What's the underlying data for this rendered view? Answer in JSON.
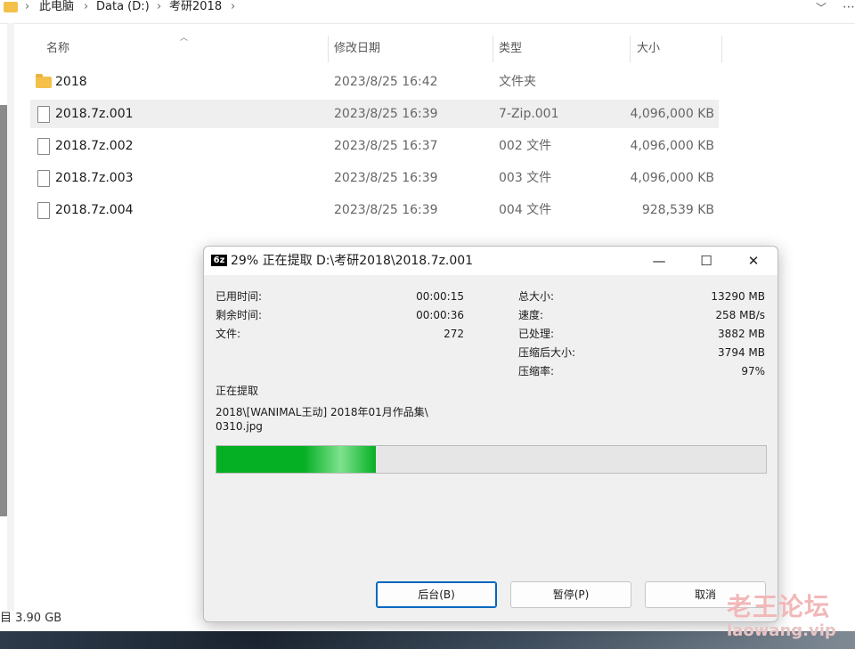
{
  "address_bar": {
    "crumbs": [
      "此电脑",
      "Data (D:)",
      "考研2018"
    ],
    "separator": "›",
    "more_glyph": "⋯",
    "dropdown_glyph": "﹀"
  },
  "columns": {
    "name": "名称",
    "date": "修改日期",
    "type": "类型",
    "size": "大小"
  },
  "files": [
    {
      "name": "2018",
      "date": "2023/8/25 16:42",
      "type": "文件夹",
      "size": "",
      "icon": "folder-icon",
      "selected": false
    },
    {
      "name": "2018.7z.001",
      "date": "2023/8/25 16:39",
      "type": "7-Zip.001",
      "size": "4,096,000 KB",
      "icon": "file-icon",
      "selected": true
    },
    {
      "name": "2018.7z.002",
      "date": "2023/8/25 16:37",
      "type": "002 文件",
      "size": "4,096,000 KB",
      "icon": "file-icon",
      "selected": false
    },
    {
      "name": "2018.7z.003",
      "date": "2023/8/25 16:39",
      "type": "003 文件",
      "size": "4,096,000 KB",
      "icon": "file-icon",
      "selected": false
    },
    {
      "name": "2018.7z.004",
      "date": "2023/8/25 16:39",
      "type": "004 文件",
      "size": "928,539 KB",
      "icon": "file-icon",
      "selected": false
    }
  ],
  "status_bar": {
    "text": "目  3.90 GB"
  },
  "dialog": {
    "icon_text": "6z",
    "title": "29% 正在提取 D:\\考研2018\\2018.7z.001",
    "minimize": "—",
    "maximize": "☐",
    "close": "✕",
    "left_stats": [
      {
        "label": "已用时间:",
        "value": "00:00:15"
      },
      {
        "label": "剩余时间:",
        "value": "00:00:36"
      },
      {
        "label": "文件:",
        "value": "272"
      }
    ],
    "right_stats": [
      {
        "label": "总大小:",
        "value": "13290 MB"
      },
      {
        "label": "速度:",
        "value": "258 MB/s"
      },
      {
        "label": "已处理:",
        "value": "3882 MB"
      },
      {
        "label": "压缩后大小:",
        "value": "3794 MB"
      },
      {
        "label": "压缩率:",
        "value": "97%"
      }
    ],
    "extracting_label": "正在提取",
    "current_path_line1": "2018\\[WANIMAL王动] 2018年01月作品集\\",
    "current_path_line2": "0310.jpg",
    "progress_percent": 29,
    "buttons": {
      "background": "后台(B)",
      "pause": "暂停(P)",
      "cancel": "取消"
    }
  },
  "watermark": {
    "line1": "老王论坛",
    "line2": "laowang.vip"
  },
  "colors": {
    "progress": "#06b025",
    "folder": "#f4c04a",
    "selection": "#efefef",
    "default_button_border": "#0067c0"
  }
}
